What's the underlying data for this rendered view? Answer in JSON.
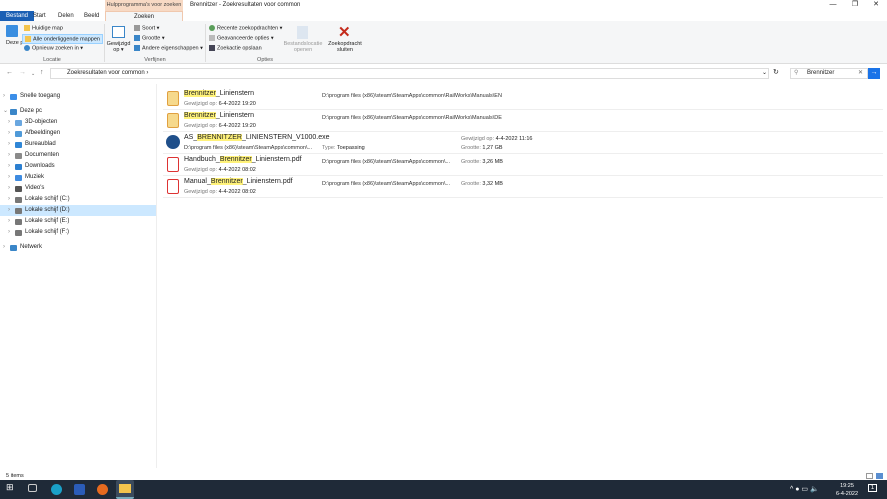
{
  "window": {
    "title": "Brennitzer - Zoekresultaten voor common",
    "context_tab": "Hulpprogramma's voor zoeken",
    "minimize": "—",
    "maximize": "❐",
    "close": "✕"
  },
  "tabs": {
    "file": "Bestand",
    "start": "Start",
    "share": "Delen",
    "view": "Beeld",
    "search": "Zoeken"
  },
  "ribbon": {
    "location": {
      "this_pc": "Deze pc",
      "current_folder": "Huidige map",
      "all_subfolders": "Alle onderliggende mappen",
      "search_again": "Opnieuw zoeken in ▾",
      "group": "Locatie"
    },
    "refine": {
      "modified": "Gewijzigd op ▾",
      "kind": "Soort ▾",
      "size": "Grootte ▾",
      "other": "Andere eigenschappen ▾",
      "group": "Verfijnen"
    },
    "options": {
      "recent": "Recente zoekopdrachten ▾",
      "advanced": "Geavanceerde opties ▾",
      "save": "Zoekactie opslaan",
      "open_location": "Bestandslocatie openen",
      "close_search": "Zoekopdracht sluiten",
      "group": "Opties"
    }
  },
  "address": {
    "path": "Zoekresultaten voor common",
    "search_value": "Brennitzer"
  },
  "sidebar": [
    {
      "label": "Snelle toegang",
      "level": 0,
      "color": "#3b8ee8"
    },
    {
      "label": "Deze pc",
      "level": 0,
      "color": "#3a86c8",
      "expanded": true
    },
    {
      "label": "3D-objecten",
      "level": 1,
      "color": "#6aa7e0"
    },
    {
      "label": "Afbeeldingen",
      "level": 1,
      "color": "#4f9ad8"
    },
    {
      "label": "Bureaublad",
      "level": 1,
      "color": "#2f86d6"
    },
    {
      "label": "Documenten",
      "level": 1,
      "color": "#8a8a8a"
    },
    {
      "label": "Downloads",
      "level": 1,
      "color": "#2c7fd0"
    },
    {
      "label": "Muziek",
      "level": 1,
      "color": "#3e8be0"
    },
    {
      "label": "Video's",
      "level": 1,
      "color": "#555"
    },
    {
      "label": "Lokale schijf (C:)",
      "level": 1,
      "color": "#777"
    },
    {
      "label": "Lokale schijf (D:)",
      "level": 1,
      "color": "#777",
      "selected": true
    },
    {
      "label": "Lokale schijf (E:)",
      "level": 1,
      "color": "#777"
    },
    {
      "label": "Lokale schijf (F:)",
      "level": 1,
      "color": "#777"
    },
    {
      "label": "Netwerk",
      "level": 0,
      "color": "#3a86c8"
    }
  ],
  "files": [
    {
      "pre": "",
      "hl": "Brennitzer",
      "post": "_Linienstern",
      "icon": "folder-doc",
      "modified_label": "Gewijzigd op:",
      "modified": "6-4-2022 19:20",
      "path": "D:\\program files (x86)\\steam\\SteamApps\\common\\RailWorks\\Manuals\\EN"
    },
    {
      "pre": "",
      "hl": "Brennitzer",
      "post": "_Linienstern",
      "icon": "folder-doc",
      "modified_label": "Gewijzigd op:",
      "modified": "6-4-2022 19:20",
      "path": "D:\\program files (x86)\\steam\\SteamApps\\common\\RailWorks\\Manuals\\DE"
    },
    {
      "pre": "AS_",
      "hl": "BRENNITZER",
      "post": "_LINIENSTERN_V1000.exe",
      "icon": "exe",
      "path": "D:\\program files (x86)\\steam\\SteamApps\\common\\...",
      "type_label": "Type:",
      "type": "Toepassing",
      "modified_label": "Gewijzigd op:",
      "modified": "4-4-2022 11:16",
      "size_label": "Grootte:",
      "size": "1,27 GB"
    },
    {
      "pre": "Handbuch_",
      "hl": "Brennitzer",
      "post": "_Linienstern.pdf",
      "icon": "pdf",
      "modified_label": "Gewijzigd op:",
      "modified": "4-4-2022 08:02",
      "path": "D:\\program files (x86)\\steam\\SteamApps\\common\\...",
      "size_label": "Grootte:",
      "size": "3,26 MB"
    },
    {
      "pre": "Manual_",
      "hl": "Brennitzer",
      "post": "_Linienstern.pdf",
      "icon": "pdf",
      "modified_label": "Gewijzigd op:",
      "modified": "4-4-2022 08:02",
      "path": "D:\\program files (x86)\\steam\\SteamApps\\common\\...",
      "size_label": "Grootte:",
      "size": "3,32 MB"
    }
  ],
  "status": {
    "count": "5 items"
  },
  "taskbar": {
    "time": "19:25",
    "date": "6-4-2022",
    "notifications": "1"
  }
}
